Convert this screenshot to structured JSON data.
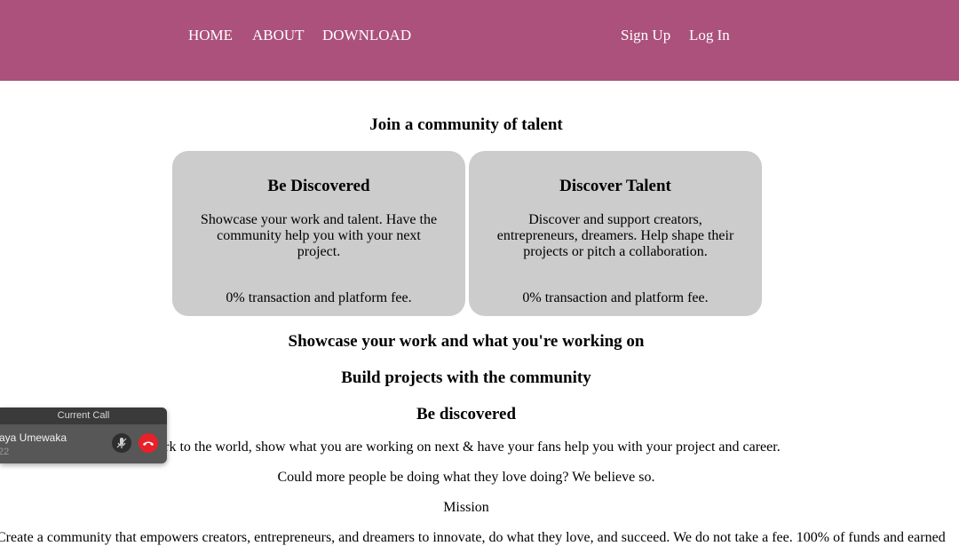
{
  "nav": {
    "home": "HOME",
    "about": "ABOUT",
    "download": "DOWNLOAD",
    "signup": "Sign Up",
    "login": "Log In"
  },
  "colors": {
    "topbar": "#ab517b",
    "card": "#cccccc",
    "hangup": "#e8202a"
  },
  "main": {
    "join_heading": "Join a community of talent",
    "cards": [
      {
        "title": "Be Discovered",
        "body": "Showcase your work and talent. Have the community help you with your next project.",
        "fee": "0% transaction and platform fee."
      },
      {
        "title": "Discover Talent",
        "body": "Discover and support creators, entrepreneurs, dreamers. Help shape their projects or pitch a collaboration.",
        "fee": "0% transaction and platform fee."
      }
    ],
    "heading_showcase": "Showcase your work and what you're working on",
    "heading_build": "Build projects with the community",
    "heading_discovered": "Be discovered",
    "para_show": "Show your best work to the world, show what you are working on next & have your fans help you with your project and career.",
    "para_question": "Could more people be doing what they love doing? We believe so.",
    "mission_label": "Mission",
    "mission_text": "Create a community that empowers creators, entrepreneurs, and dreamers to innovate, do what they love, and succeed. We do not take a fee. 100% of funds and earned"
  },
  "call": {
    "header": "Current Call",
    "name": "aya Umewaka",
    "time": "22",
    "mute_icon": "mic-off-icon",
    "hangup_icon": "phone-hangup-icon"
  }
}
